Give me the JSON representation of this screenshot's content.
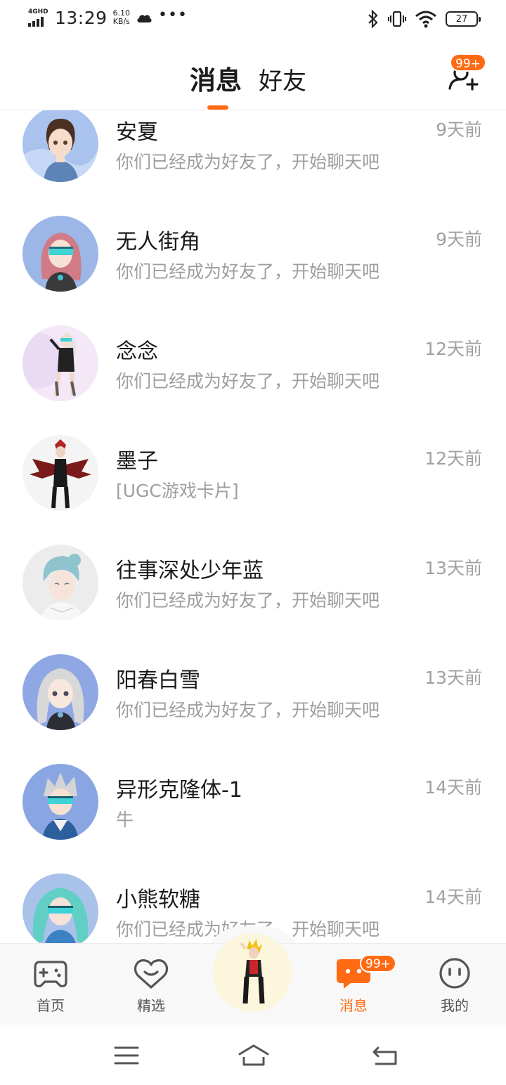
{
  "status_bar": {
    "network": "4GHD",
    "time": "13:29",
    "speed_value": "6.10",
    "speed_unit": "KB/s",
    "more": "•••",
    "battery": "27"
  },
  "header": {
    "tab_active": "消息",
    "tab_inactive": "好友",
    "friend_request_badge": "99+"
  },
  "conversations": [
    {
      "name": "安夏",
      "message": "你们已经成为好友了，开始聊天吧",
      "time": "9天前"
    },
    {
      "name": "无人街角",
      "message": "你们已经成为好友了，开始聊天吧",
      "time": "9天前"
    },
    {
      "name": "念念",
      "message": "你们已经成为好友了，开始聊天吧",
      "time": "12天前"
    },
    {
      "name": "墨子",
      "message": "[UGC游戏卡片]",
      "time": "12天前"
    },
    {
      "name": "往事深处少年蓝",
      "message": "你们已经成为好友了，开始聊天吧",
      "time": "13天前"
    },
    {
      "name": "阳春白雪",
      "message": "你们已经成为好友了，开始聊天吧",
      "time": "13天前"
    },
    {
      "name": "异形克隆体-1",
      "message": "牛",
      "time": "14天前"
    },
    {
      "name": "小熊软糖",
      "message": "你们已经成为好友了，开始聊天吧",
      "time": "14天前"
    }
  ],
  "bottom_nav": {
    "home": "首页",
    "featured": "精选",
    "messages": "消息",
    "messages_badge": "99+",
    "me": "我的"
  },
  "colors": {
    "accent": "#ff6a13",
    "secondary_text": "#9e9e9e"
  },
  "icons": [
    "gamepad-icon",
    "heart-chat-icon",
    "chat-bubble-icon",
    "smiley-icon",
    "add-friend-icon",
    "menu-icon",
    "home-icon",
    "back-icon"
  ]
}
